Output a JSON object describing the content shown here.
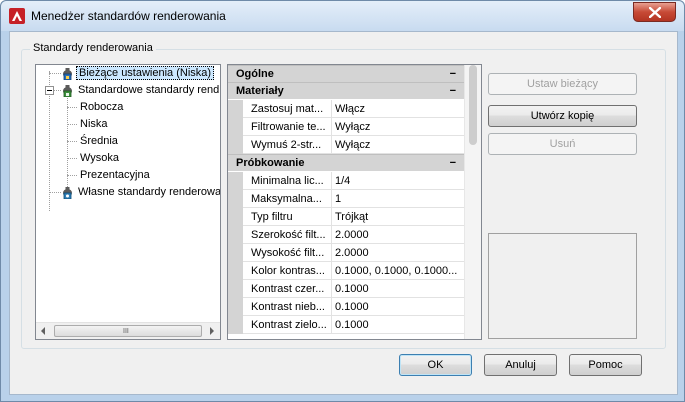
{
  "window": {
    "title": "Menedżer standardów renderowania",
    "icon": "autocad-icon",
    "close_icon": "close-icon"
  },
  "group": {
    "label": "Standardy renderowania"
  },
  "tree": {
    "items": [
      {
        "label": "Bieżące ustawienia (Niska)",
        "level": 0,
        "selected": true,
        "icon": "teapot-icon"
      },
      {
        "label": "Standardowe standardy rend",
        "level": 0,
        "expanded": true,
        "icon": "teapot-lock-icon"
      },
      {
        "label": "Robocza",
        "level": 1
      },
      {
        "label": "Niska",
        "level": 1
      },
      {
        "label": "Średnia",
        "level": 1
      },
      {
        "label": "Wysoka",
        "level": 1
      },
      {
        "label": "Prezentacyjna",
        "level": 1
      },
      {
        "label": "Własne standardy renderowa",
        "level": 0,
        "icon": "teapot-user-icon"
      }
    ],
    "scroll_grip": "III"
  },
  "properties": {
    "categories": [
      {
        "name": "Ogólne",
        "toggle": "−",
        "rows": []
      },
      {
        "name": "Materiały",
        "toggle": "−",
        "rows": [
          {
            "name": "Zastosuj mat...",
            "value": "Włącz"
          },
          {
            "name": "Filtrowanie te...",
            "value": "Wyłącz"
          },
          {
            "name": "Wymuś 2-str...",
            "value": "Wyłącz"
          }
        ]
      },
      {
        "name": "Próbkowanie",
        "toggle": "−",
        "rows": [
          {
            "name": "Minimalna lic...",
            "value": "1/4"
          },
          {
            "name": "Maksymalna...",
            "value": "1"
          },
          {
            "name": "Typ filtru",
            "value": "Trójkąt"
          },
          {
            "name": "Szerokość filt...",
            "value": "2.0000"
          },
          {
            "name": "Wysokość filt...",
            "value": "2.0000"
          },
          {
            "name": "Kolor kontras...",
            "value": "0.1000, 0.1000, 0.1000..."
          },
          {
            "name": "Kontrast czer...",
            "value": "0.1000"
          },
          {
            "name": "Kontrast nieb...",
            "value": "0.1000"
          },
          {
            "name": "Kontrast zielo...",
            "value": "0.1000"
          }
        ]
      }
    ]
  },
  "side_buttons": {
    "set_current": "Ustaw bieżący",
    "create_copy": "Utwórz kopię",
    "delete": "Usuń"
  },
  "footer_buttons": {
    "ok": "OK",
    "cancel": "Anuluj",
    "help": "Pomoc"
  },
  "colors": {
    "titlebar": "#c8dbf0",
    "dialog_bg": "#f0f0f0",
    "category_bg": "#d4d4d4",
    "close_red": "#c74a36"
  }
}
